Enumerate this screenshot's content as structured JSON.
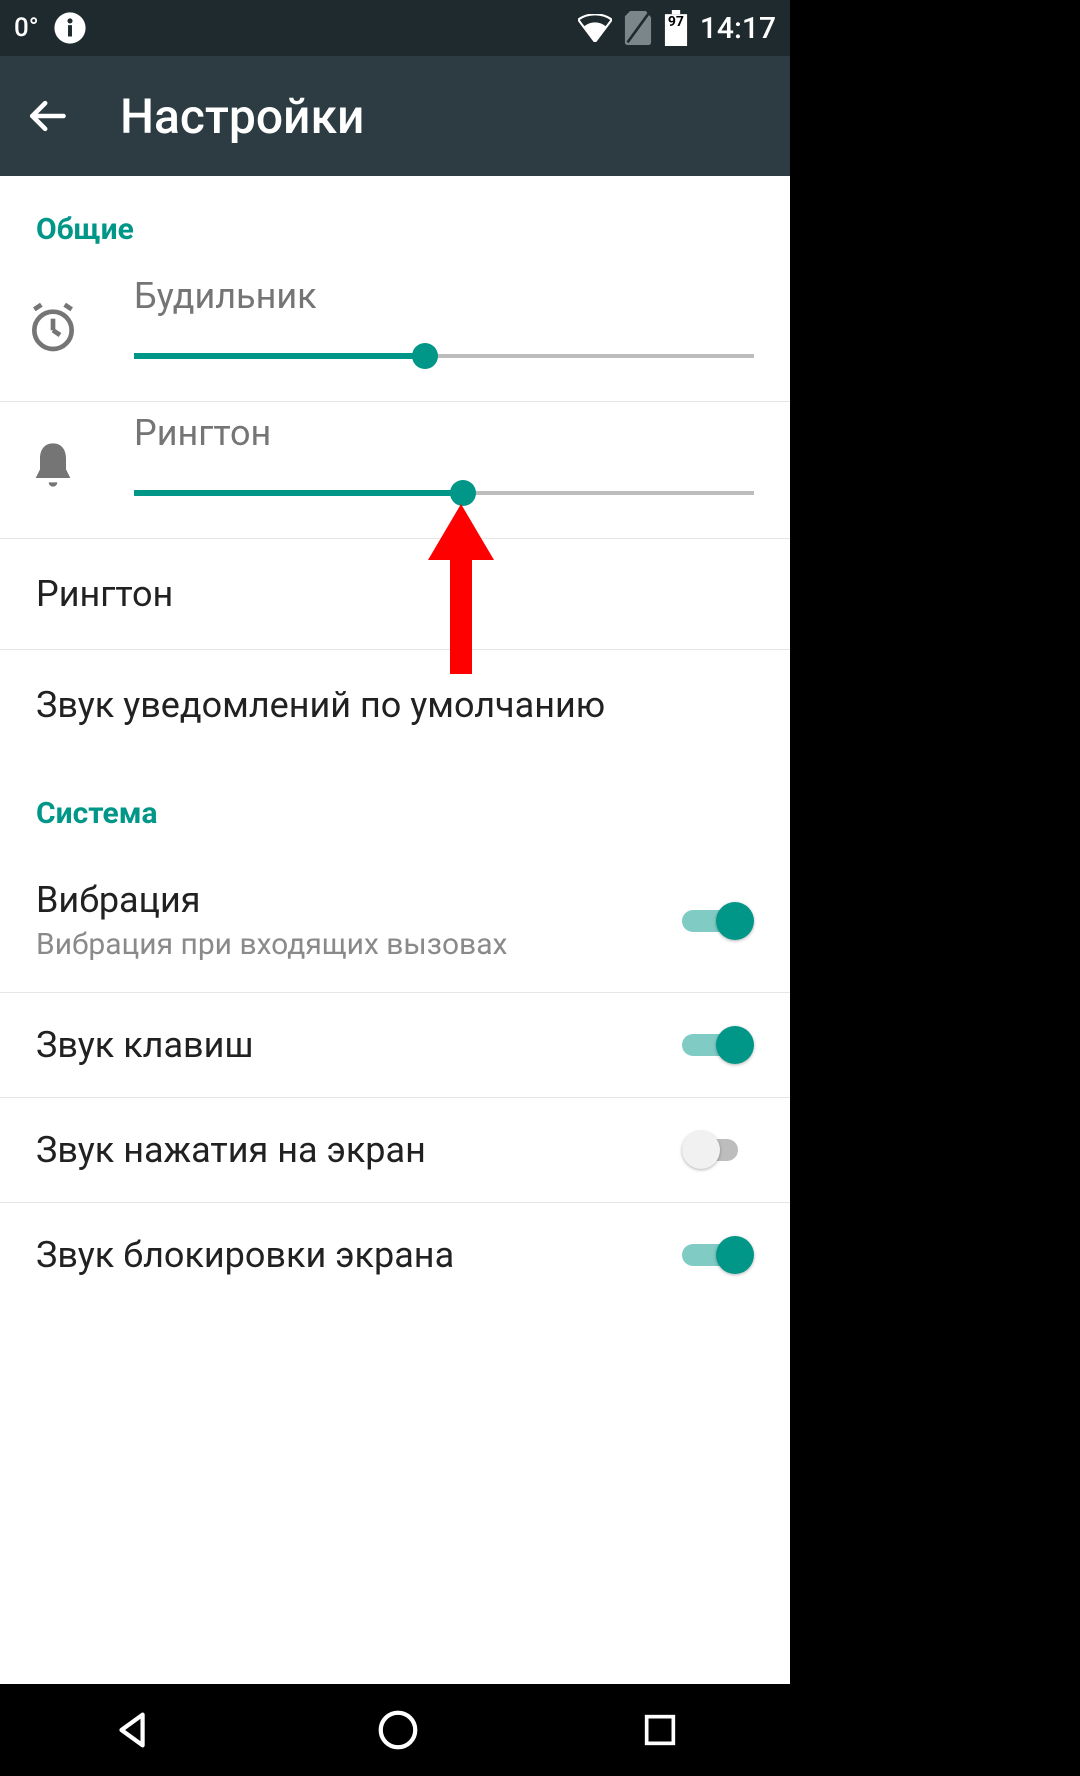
{
  "status": {
    "temp": "0°",
    "battery": "97",
    "time": "14:17"
  },
  "appbar": {
    "title": "Настройки"
  },
  "sections": {
    "general": {
      "header": "Общие",
      "alarm": {
        "label": "Будильник",
        "pct": 47
      },
      "ringtone_volume": {
        "label": "Рингтон",
        "pct": 53
      },
      "ringtone_row": "Рингтон",
      "default_notif": "Звук уведомлений по умолчанию"
    },
    "system": {
      "header": "Система",
      "vibration": {
        "title": "Вибрация",
        "sub": "Вибрация при входящих вызовах",
        "on": true
      },
      "keytones": {
        "title": "Звук клавиш",
        "on": true
      },
      "touchsound": {
        "title": "Звук нажатия на экран",
        "on": false
      },
      "locksound": {
        "title": "Звук блокировки экрана",
        "on": true
      }
    }
  }
}
